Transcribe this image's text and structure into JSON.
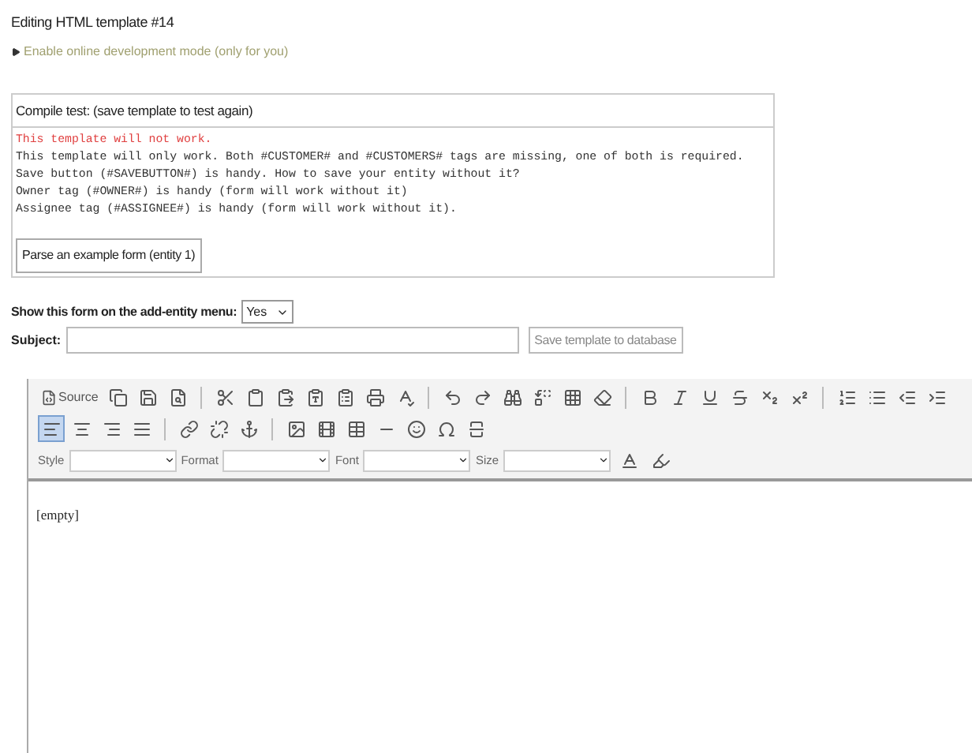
{
  "page_title": "Editing HTML template #14",
  "dev_mode_link": {
    "label": "Enable online development mode (only for you)",
    "expanded": false
  },
  "compile_test": {
    "header": "Compile test: (save template to test again)",
    "messages": [
      {
        "kind": "error",
        "text": "This template will not work."
      },
      {
        "kind": "info",
        "text": "This template will only work. Both #CUSTOMER# and #CUSTOMERS# tags are missing, one of both is required."
      },
      {
        "kind": "info",
        "text": "Save button (#SAVEBUTTON#) is handy. How to save your entity without it?"
      },
      {
        "kind": "info",
        "text": "Owner tag (#OWNER#) is handy (form will work without it)"
      },
      {
        "kind": "info",
        "text": "Assignee tag (#ASSIGNEE#) is handy (form will work without it)."
      }
    ],
    "parse_button": "Parse an example form (entity 1)"
  },
  "menu_option": {
    "label": "Show this form on the add-entity menu:",
    "value": "Yes"
  },
  "subject": {
    "label": "Subject:"
  },
  "save_button": "Save template to database",
  "editor": {
    "source_button": "Source",
    "alignment": [
      {
        "selected": true
      },
      {
        "selected": false
      },
      {
        "selected": false
      },
      {
        "selected": false
      }
    ],
    "combos": [
      {
        "label": "Style"
      },
      {
        "label": "Format"
      },
      {
        "label": "Font"
      },
      {
        "label": "Size"
      }
    ],
    "content": "[empty]"
  }
}
